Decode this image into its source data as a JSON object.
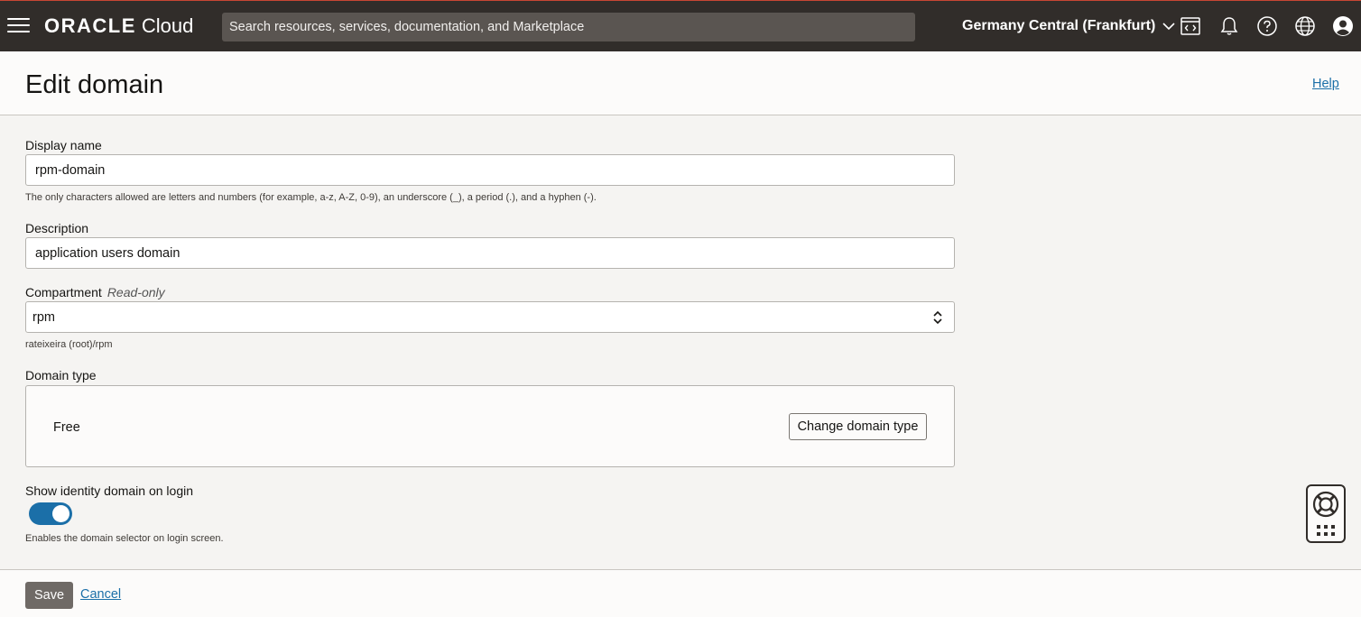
{
  "topbar": {
    "brand_oracle": "ORACLE",
    "brand_cloud": "Cloud",
    "search_placeholder": "Search resources, services, documentation, and Marketplace",
    "region": "Germany Central (Frankfurt)",
    "icons": [
      "hamburger-menu-icon",
      "code-editor-icon",
      "bell-icon",
      "help-circle-icon",
      "globe-icon",
      "user-avatar-icon"
    ]
  },
  "header": {
    "title": "Edit domain",
    "help": "Help"
  },
  "form": {
    "display_name_label": "Display name",
    "display_name_value": "rpm-domain",
    "display_name_hint": "The only characters allowed are letters and numbers (for example, a-z, A-Z, 0-9), an underscore (_), a period (.), and a hyphen (-).",
    "description_label": "Description",
    "description_value": "application users domain",
    "compartment_label": "Compartment",
    "compartment_readonly": "Read-only",
    "compartment_value": "rpm",
    "compartment_path": "rateixeira (root)/rpm",
    "domain_type_label": "Domain type",
    "domain_type_value": "Free",
    "change_domain_type": "Change domain type",
    "show_identity_label": "Show identity domain on login",
    "show_identity_enabled": true,
    "show_identity_hint": "Enables the domain selector on login screen."
  },
  "footer": {
    "save": "Save",
    "cancel": "Cancel"
  },
  "colors": {
    "topbar": "#312d2a",
    "accent_top": "#c74634",
    "link": "#1b6fa8",
    "toggle_on": "#1b6fa8",
    "save_button": "#6f6a66"
  }
}
